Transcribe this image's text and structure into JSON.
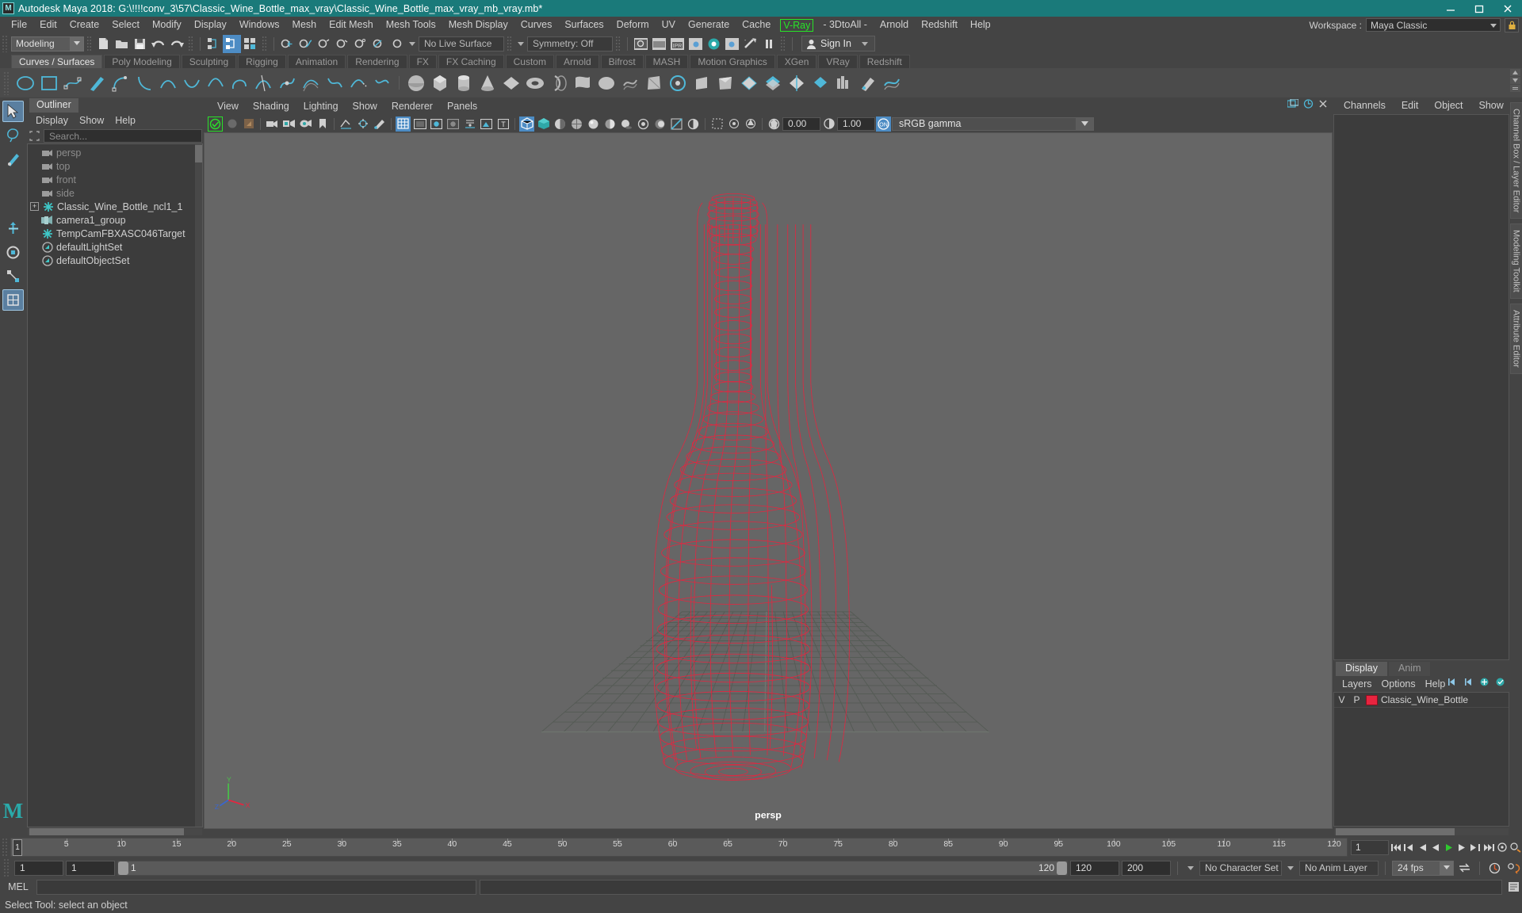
{
  "window": {
    "title": "Autodesk Maya 2018: G:\\!!!!conv_3\\57\\Classic_Wine_Bottle_max_vray\\Classic_Wine_Bottle_max_vray_mb_vray.mb*",
    "app_icon": "maya-logo-icon",
    "minimize": "minimize-button",
    "maximize": "maximize-button",
    "close": "close-button"
  },
  "menubar": {
    "items": [
      {
        "label": "File"
      },
      {
        "label": "Edit"
      },
      {
        "label": "Create"
      },
      {
        "label": "Select"
      },
      {
        "label": "Modify"
      },
      {
        "label": "Display"
      },
      {
        "label": "Windows"
      },
      {
        "label": "Mesh"
      },
      {
        "label": "Edit Mesh"
      },
      {
        "label": "Mesh Tools"
      },
      {
        "label": "Mesh Display"
      },
      {
        "label": "Curves"
      },
      {
        "label": "Surfaces"
      },
      {
        "label": "Deform"
      },
      {
        "label": "UV"
      },
      {
        "label": "Generate"
      },
      {
        "label": "Cache"
      },
      {
        "label": "V-Ray",
        "highlight": true
      },
      {
        "label": "- 3DtoAll -"
      },
      {
        "label": "Arnold"
      },
      {
        "label": "Redshift"
      },
      {
        "label": "Help"
      }
    ],
    "highlight_color": "#27e327",
    "workspace_label": "Workspace :",
    "workspace_value": "Maya Classic",
    "lock_icon": "lock-icon"
  },
  "statusline": {
    "mode_menu": "Modeling",
    "live_surface": "No Live Surface",
    "symmetry": "Symmetry: Off",
    "sign_in": "Sign In",
    "sign_in_icon": "person-icon"
  },
  "shelf": {
    "tabs": [
      "Curves / Surfaces",
      "Poly Modeling",
      "Sculpting",
      "Rigging",
      "Animation",
      "Rendering",
      "FX",
      "FX Caching",
      "Custom",
      "Arnold",
      "Bifrost",
      "MASH",
      "Motion Graphics",
      "XGen",
      "VRay",
      "Redshift"
    ],
    "active_tab": "Curves / Surfaces"
  },
  "outliner": {
    "tab": "Outliner",
    "menus": [
      "Display",
      "Show",
      "Help"
    ],
    "search_placeholder": "Search...",
    "search_icon": "search-scope-icon",
    "items": [
      {
        "label": "persp",
        "icon": "camera-icon",
        "dim": true,
        "expand": false
      },
      {
        "label": "top",
        "icon": "camera-icon",
        "dim": true,
        "expand": false
      },
      {
        "label": "front",
        "icon": "camera-icon",
        "dim": true,
        "expand": false
      },
      {
        "label": "side",
        "icon": "camera-icon",
        "dim": true,
        "expand": false
      },
      {
        "label": "Classic_Wine_Bottle_ncl1_1",
        "icon": "transform-icon",
        "dim": false,
        "expand": true
      },
      {
        "label": "camera1_group",
        "icon": "group-icon",
        "dim": false,
        "expand": false
      },
      {
        "label": "TempCamFBXASC046Target",
        "icon": "transform-icon",
        "dim": false,
        "expand": false
      },
      {
        "label": "defaultLightSet",
        "icon": "set-icon",
        "dim": false,
        "expand": false
      },
      {
        "label": "defaultObjectSet",
        "icon": "set-icon",
        "dim": false,
        "expand": false
      }
    ]
  },
  "viewport": {
    "menus": [
      "View",
      "Shading",
      "Lighting",
      "Show",
      "Renderer",
      "Panels"
    ],
    "exposure_value": "0.00",
    "gamma_value": "1.00",
    "color_management": "sRGB gamma",
    "camera_label": "persp",
    "wireframe_color": "#e8243f",
    "background_color": "#666666",
    "grid_color": "#4e4e4e",
    "axis_labels": {
      "y": "Y",
      "x": "X",
      "z": "Z"
    }
  },
  "rightpanel": {
    "tabs": [
      "Channels",
      "Edit",
      "Object",
      "Show"
    ],
    "layer_tabs": [
      "Display",
      "Anim"
    ],
    "active_layer_tab": "Display",
    "layer_menus": [
      "Layers",
      "Options",
      "Help"
    ],
    "columns": [
      "V",
      "P"
    ],
    "layers": [
      {
        "v": "V",
        "p": "P",
        "color": "#e8243f",
        "name": "Classic_Wine_Bottle"
      }
    ],
    "vertical_tabs": [
      "Channel Box / Layer Editor",
      "Modeling Toolkit",
      "Attribute Editor"
    ]
  },
  "timeline": {
    "start_label": "1",
    "current_frame": "1",
    "ticks": [
      5,
      10,
      15,
      20,
      25,
      30,
      35,
      40,
      45,
      50,
      55,
      60,
      65,
      70,
      75,
      80,
      85,
      90,
      95,
      100,
      105,
      110,
      115,
      120
    ],
    "playback_start": "1",
    "playback_end": "120",
    "range_start": "1",
    "range_end": "120",
    "anim_start": "120",
    "anim_end": "200",
    "character_set": "No Character Set",
    "anim_layer": "No Anim Layer",
    "fps": "24 fps",
    "frame_field": "1"
  },
  "command": {
    "mel_label": "MEL",
    "input_value": "",
    "output_value": ""
  },
  "helpline": {
    "text": "Select Tool: select an object"
  }
}
